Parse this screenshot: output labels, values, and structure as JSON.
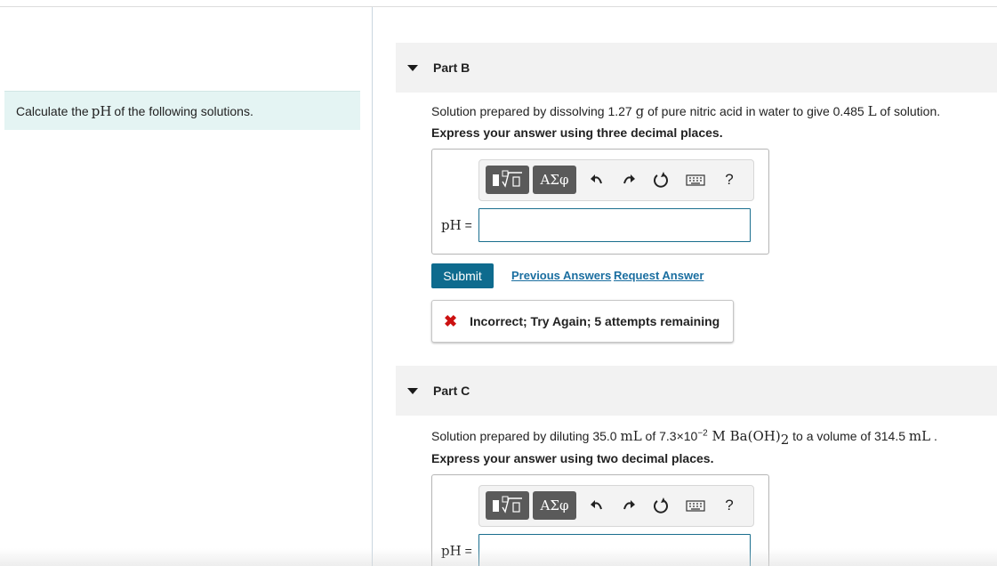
{
  "intro": {
    "text_before": "Calculate the ",
    "math": "pH",
    "text_after": " of the following solutions."
  },
  "part_b": {
    "title": "Part B",
    "question": {
      "t1": "Solution prepared by dissolving 1.27 ",
      "m1": "g",
      "t2": " of pure nitric acid in water to give 0.485 ",
      "m2": "L",
      "t3": " of solution."
    },
    "instruction": "Express your answer using three decimal places.",
    "answer_label": "pH",
    "answer_eq": " =",
    "answer_value": "",
    "submit_label": "Submit",
    "previous_answers": "Previous Answers",
    "request_answer": "Request Answer",
    "feedback": "Incorrect; Try Again; 5 attempts remaining"
  },
  "part_c": {
    "title": "Part C",
    "question": {
      "t1": "Solution prepared by diluting 35.0 ",
      "m1": "mL",
      "t2": " of 7.3×10",
      "exp": "−2",
      "m2": " M Ba(OH)",
      "sub": "2",
      "t3": "  to a volume of 314.5 ",
      "m3": "mL",
      "t4": " ."
    },
    "instruction": "Express your answer using two decimal places.",
    "answer_label": "pH",
    "answer_eq": " =",
    "answer_value": ""
  },
  "toolbar": {
    "greek_label": "ΑΣφ",
    "help_label": "?"
  },
  "colors": {
    "accent": "#0e6b8e",
    "link": "#1a6ea0",
    "error": "#cc1111",
    "intro_bg": "#e4f4f3"
  },
  "icons": [
    "templates-icon",
    "undo-icon",
    "redo-icon",
    "reset-icon",
    "keyboard-icon",
    "caret-down-icon",
    "error-x-icon"
  ]
}
